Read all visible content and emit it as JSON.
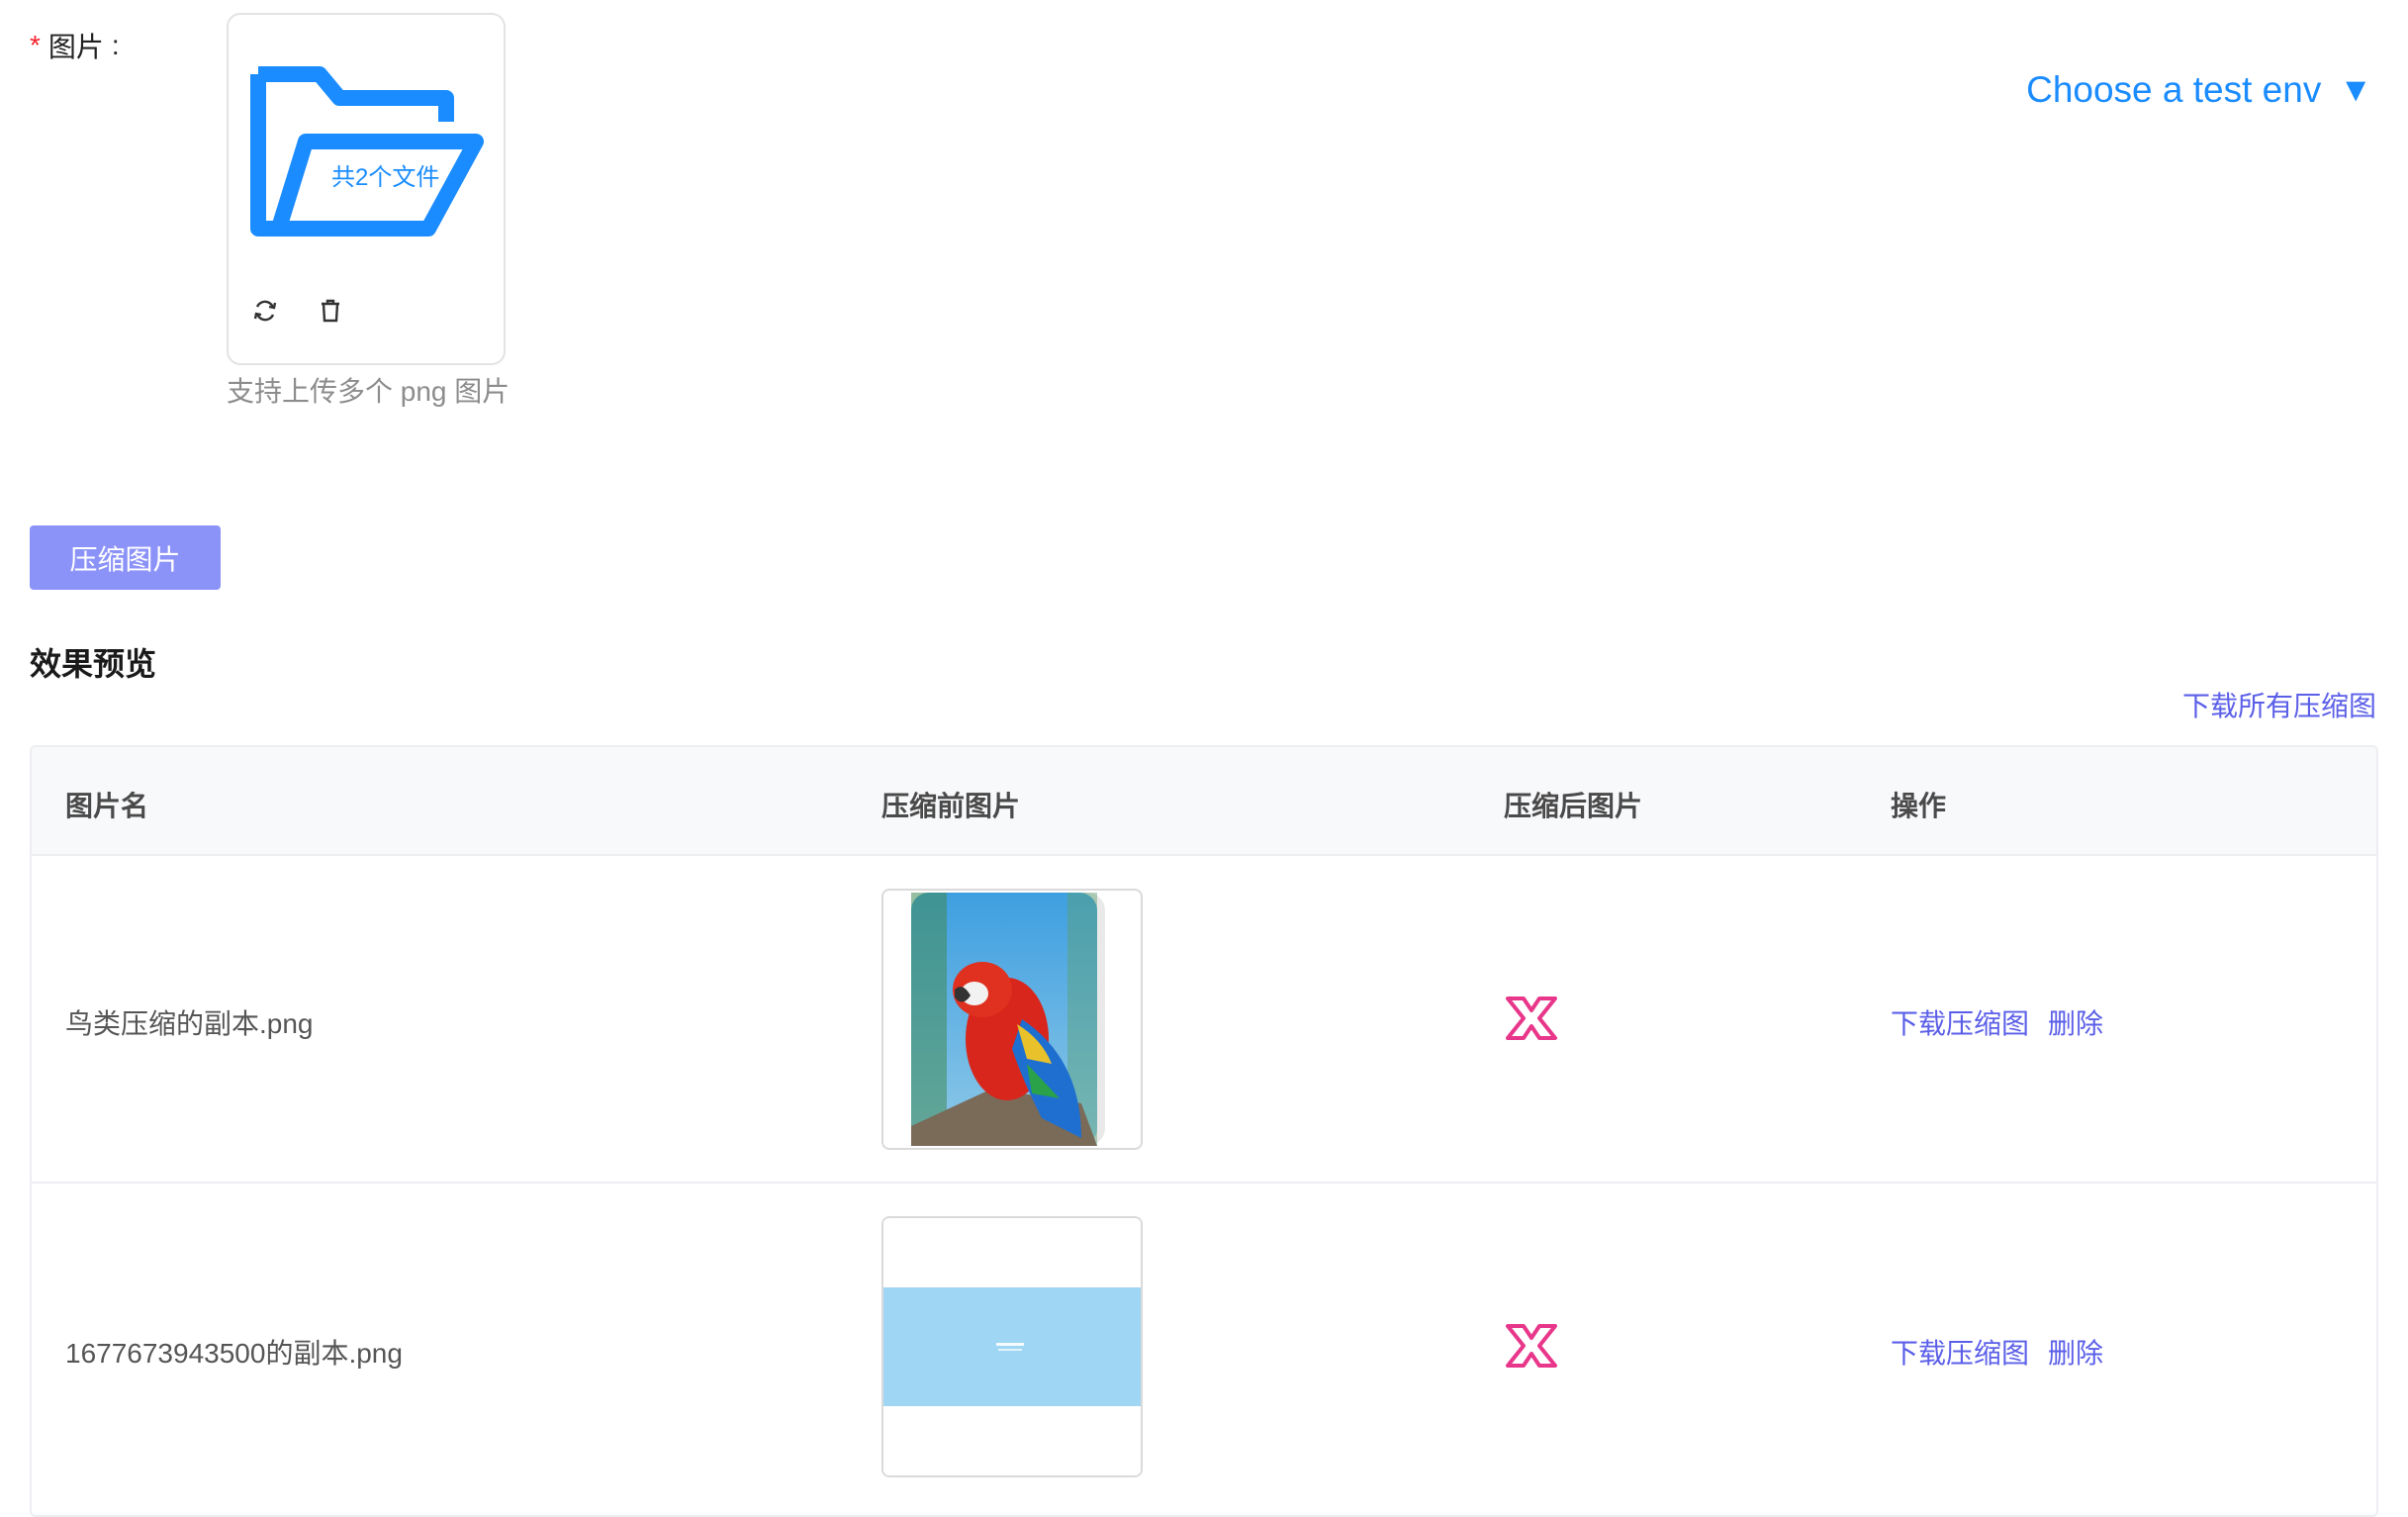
{
  "form": {
    "label": "图片",
    "colon": ":",
    "required_mark": "*",
    "upload": {
      "folder_text": "共2个文件",
      "hint": "支持上传多个 png 图片",
      "actions": [
        "refresh-icon",
        "trash-icon"
      ]
    }
  },
  "env_select": {
    "label": "Choose a test env",
    "arrow": "▼"
  },
  "compress_button": "压缩图片",
  "preview": {
    "title": "效果预览",
    "download_all": "下载所有压缩图"
  },
  "table": {
    "headers": [
      "图片名",
      "压缩前图片",
      "压缩后图片",
      "操作"
    ],
    "rows": [
      {
        "name": "鸟类压缩的副本.png",
        "before": "parrot photo",
        "after_icon": "broken-image-x-icon",
        "actions": [
          "下载压缩图",
          "删除"
        ]
      },
      {
        "name": "1677673943500的副本.png",
        "before": "light blue banner",
        "after_icon": "broken-image-x-icon",
        "actions": [
          "下载压缩图",
          "删除"
        ]
      }
    ]
  },
  "colors": {
    "accent_blue": "#1a8cff",
    "link_purple": "#5b5fe8",
    "button_bg": "#8c93f8",
    "error_icon": "#e8378a"
  }
}
